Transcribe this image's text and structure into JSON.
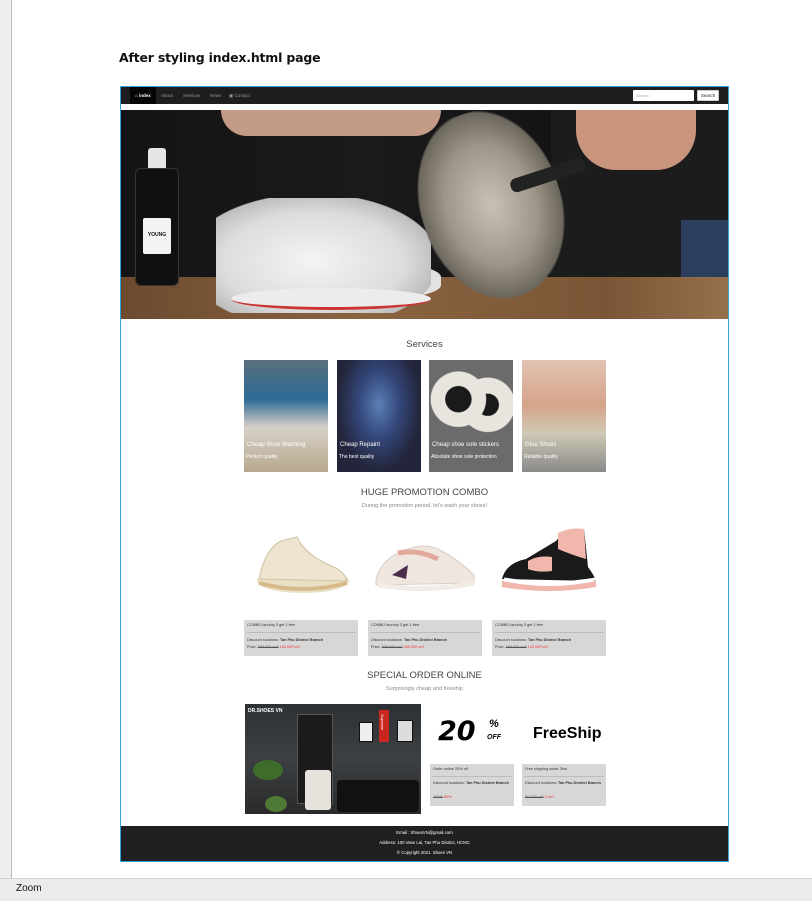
{
  "document": {
    "heading": "After styling index.html page"
  },
  "navbar": {
    "home_label": "index",
    "about_label": "About",
    "services_label": "Services",
    "news_label": "News",
    "contact_label": "Contact",
    "search_placeholder": "Search",
    "search_button": "Search"
  },
  "services": {
    "title": "Services",
    "cards": [
      {
        "label": "Cheap Shoe Washing",
        "sub": "Perfect quality"
      },
      {
        "label": "Cheap Repaint",
        "sub": "The best quality"
      },
      {
        "label": "Cheap shoe sole stickers",
        "sub": "Absolute shoe sole protection"
      },
      {
        "label": "Glue Shoes",
        "sub": "Reliable quality"
      }
    ]
  },
  "promotion": {
    "title": "HUGE PROMOTION COMBO",
    "subtitle": "During the promotion period, let's wash your shoes!",
    "products": [
      {
        "name": "COMBO laundry 3 get 1 free",
        "location_label": "Discount locations:",
        "location": "Tan Phu District Branch",
        "price_label": "Price:",
        "old_price": "200.000 vn₫",
        "new_price": "150.000 vn₫"
      },
      {
        "name": "COMBO laundry 3 get 1 free",
        "location_label": "Discount locations:",
        "location": "Tan Phu District Branch",
        "price_label": "Price:",
        "old_price": "600.000 vn₫",
        "new_price": "450.000 vn₫"
      },
      {
        "name": "COMBO laundry 3 get 1 free",
        "location_label": "Discount locations:",
        "location": "Tan Phu District Branch",
        "price_label": "Price:",
        "old_price": "160.000 vn₫",
        "new_price": "120.000 vn₫"
      }
    ]
  },
  "special": {
    "title": "SPECIAL ORDER ONLINE",
    "subtitle": "Surprisingly cheap and freeship",
    "store_sign": "DR.SHOES VN",
    "store_poster": "Supreme",
    "offers": [
      {
        "banner": "20",
        "banner_pct": "%",
        "banner_off": "OFF",
        "name": "Order online 20% off",
        "location_label": "Discount locations:",
        "location": "Tan Phu District Branch",
        "old_price": "100%",
        "new_price": "80%"
      },
      {
        "banner": "FreeShip",
        "name": "Free shipping under 3km",
        "location_label": "Discount locations:",
        "location": "Tan Phu District Branch",
        "old_price": "60.000 vn₫",
        "new_price": "0 vn₫"
      }
    ]
  },
  "footer": {
    "email": "Email : ShoesVN@gmail.com",
    "address": "Address: 100 Vase Lai, Tan Phu District, HCMC",
    "copyright": "© Copyright 2021. Shoes VN"
  },
  "hero": {
    "bottle_brand": "YOUNG"
  },
  "statusbar": {
    "label": "Zoom"
  },
  "colors": {
    "frame_border": "#2ea3dd",
    "navbar_bg": "#1e1e1e",
    "footer_bg": "#202020",
    "price_red": "#e33333"
  }
}
